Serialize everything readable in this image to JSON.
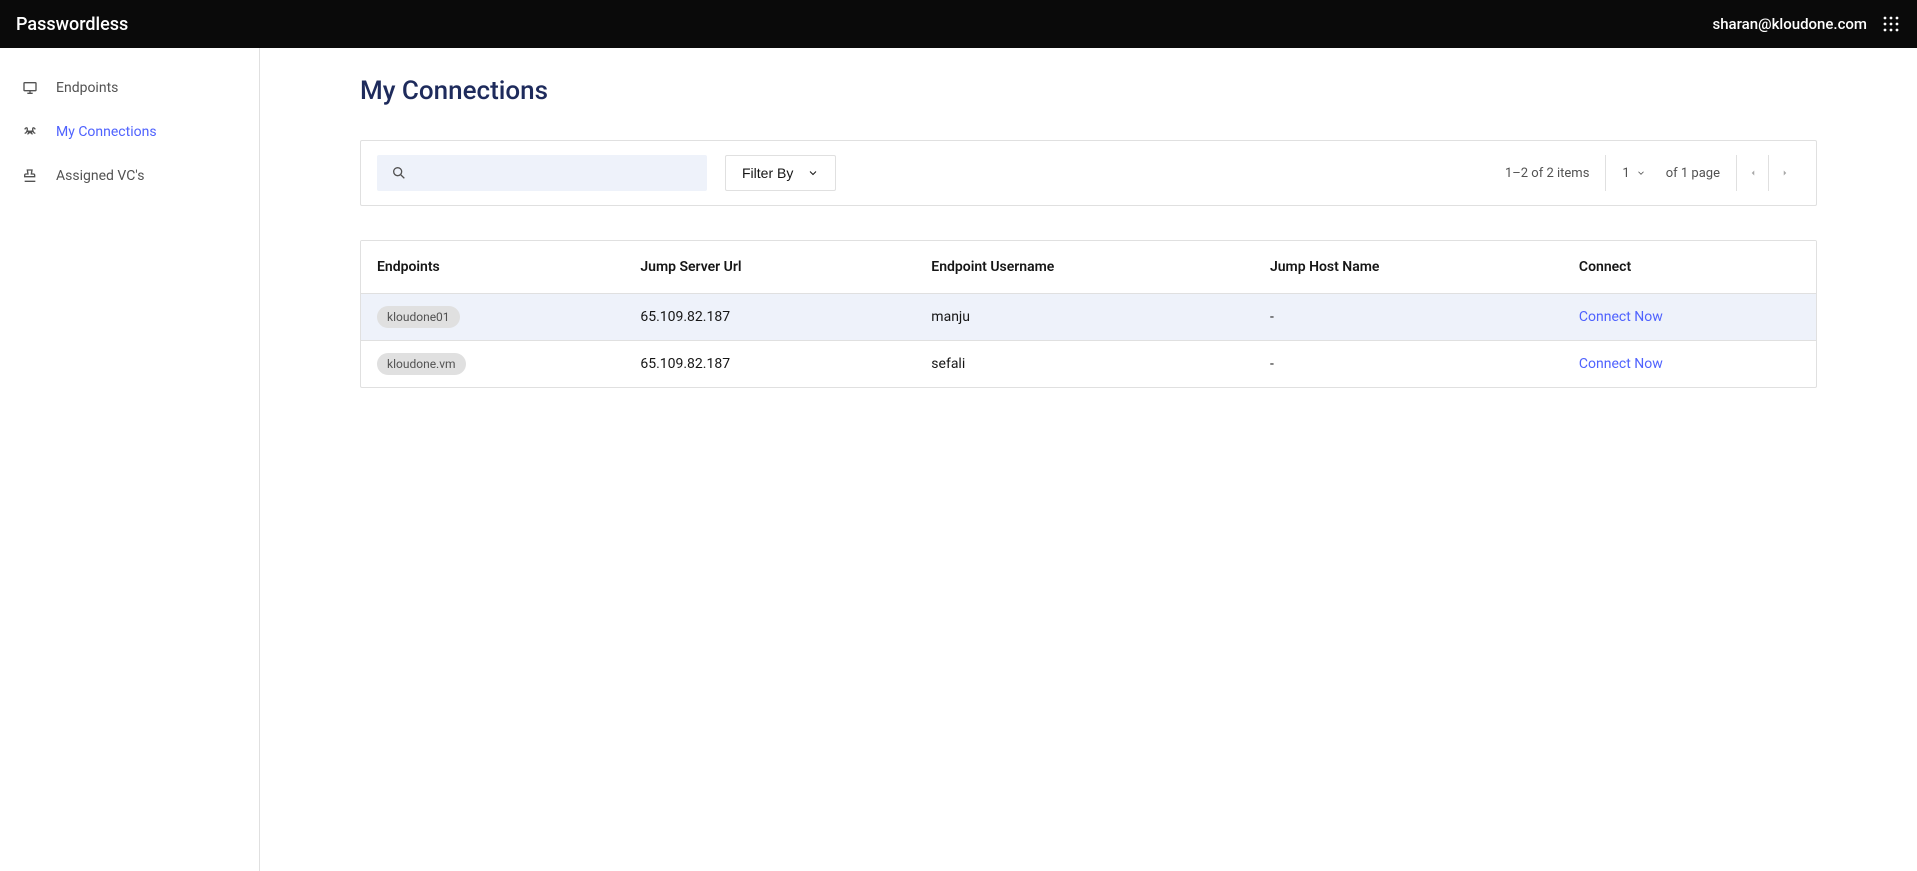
{
  "brand": "Passwordless",
  "user_email": "sharan@kloudone.com",
  "sidebar": {
    "items": [
      {
        "label": "Endpoints",
        "icon": "monitor-icon",
        "active": false
      },
      {
        "label": "My Connections",
        "icon": "signal-icon",
        "active": true
      },
      {
        "label": "Assigned VC's",
        "icon": "stamp-icon",
        "active": false
      }
    ]
  },
  "page": {
    "title": "My Connections"
  },
  "toolbar": {
    "search_placeholder": "",
    "filter_label": "Filter By"
  },
  "pagination": {
    "range_text": "1–2 of 2 items",
    "current_page": "1",
    "page_suffix": "of 1 page"
  },
  "table": {
    "headers": [
      "Endpoints",
      "Jump Server Url",
      "Endpoint Username",
      "Jump Host Name",
      "Connect"
    ],
    "rows": [
      {
        "endpoint": "kloudone01",
        "jump_url": "65.109.82.187",
        "username": "manju",
        "hostname": "-",
        "action": "Connect Now",
        "highlight": true
      },
      {
        "endpoint": "kloudone.vm",
        "jump_url": "65.109.82.187",
        "username": "sefali",
        "hostname": "-",
        "action": "Connect Now",
        "highlight": false
      }
    ]
  }
}
